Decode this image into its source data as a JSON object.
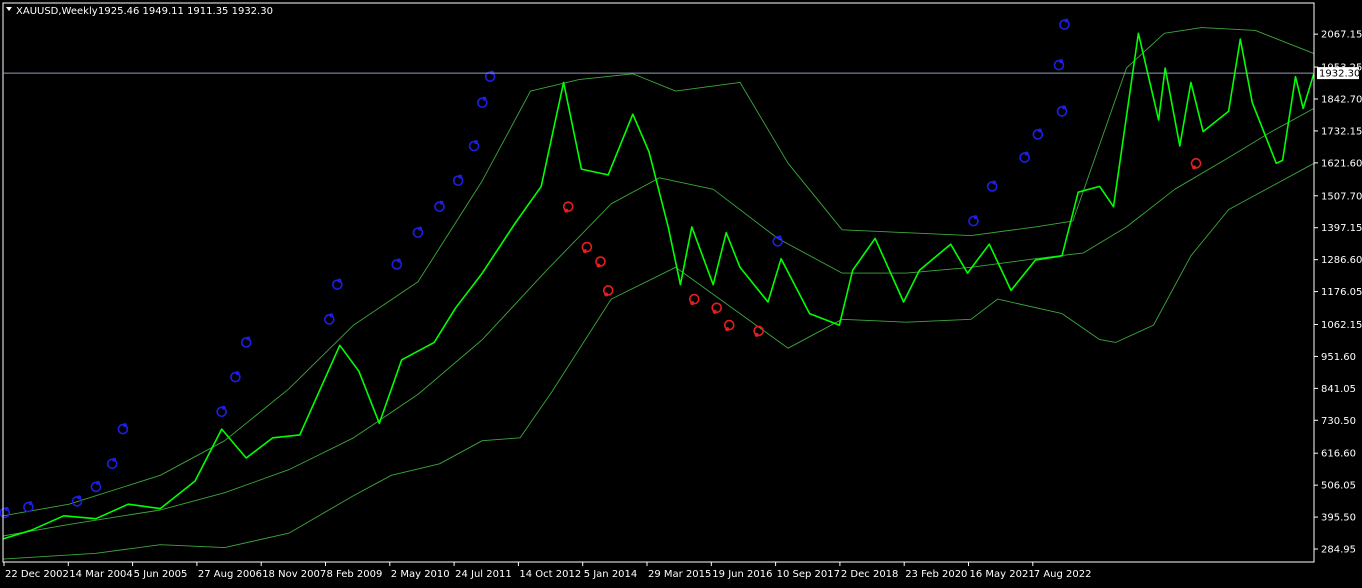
{
  "header": {
    "symbol_title": "XAUUSD,Weekly",
    "ohlc": "1925.46 1949.11 1911.35 1932.30"
  },
  "colors": {
    "background": "#000000",
    "frame": "#ffffff",
    "text": "#ffffff",
    "price": "#00ff00",
    "bands": "#3ca83c",
    "price_line": "#8fa0b3",
    "price_tag_bg": "#ffffff",
    "price_tag_text": "#000000",
    "buy_marker": "#1e1ee6",
    "sell_marker": "#e61e1e"
  },
  "chart_data": {
    "type": "line",
    "title": "",
    "xlabel": "",
    "ylabel": "",
    "ylim": [
      240,
      2175
    ],
    "x_range": [
      "2002-12-22",
      "2023-04-30"
    ],
    "grid": false,
    "y_ticks": [
      "2067.15",
      "1953.25",
      "1842.70",
      "1732.15",
      "1621.60",
      "1507.70",
      "1397.15",
      "1286.60",
      "1176.05",
      "1062.15",
      "951.60",
      "841.05",
      "730.50",
      "616.60",
      "506.05",
      "395.50",
      "284.95"
    ],
    "x_ticks": [
      "22 Dec 2002",
      "14 Mar 2004",
      "5 Jun 2005",
      "27 Aug 2006",
      "18 Nov 2007",
      "8 Feb 2009",
      "2 May 2010",
      "24 Jul 2011",
      "14 Oct 2012",
      "5 Jan 2014",
      "29 Mar 2015",
      "19 Jun 2016",
      "10 Sep 2017",
      "2 Dec 2018",
      "23 Feb 2020",
      "16 May 2021",
      "7 Aug 2022"
    ],
    "current_price": {
      "value": 1932.3,
      "label": "1932.30"
    },
    "series": [
      {
        "type": "line",
        "x": [
          "2002-12-22",
          "2003-06-01",
          "2003-12-01",
          "2004-06-01",
          "2004-12-01",
          "2005-06-01",
          "2005-12-15",
          "2006-05-15",
          "2006-10-01",
          "2007-03-01",
          "2007-08-01",
          "2008-03-15",
          "2008-07-01",
          "2008-10-25",
          "2009-03-01",
          "2009-09-01",
          "2010-01-01",
          "2010-06-01",
          "2010-12-01",
          "2011-05-01",
          "2011-09-05",
          "2011-12-15",
          "2012-05-15",
          "2012-10-01",
          "2013-01-01",
          "2013-04-20",
          "2013-06-28",
          "2013-09-01",
          "2013-12-31",
          "2014-03-15",
          "2014-06-01",
          "2014-11-07",
          "2015-01-20",
          "2015-07-01",
          "2015-12-17",
          "2016-03-01",
          "2016-07-06",
          "2016-12-15",
          "2017-03-15",
          "2017-09-08",
          "2017-12-12",
          "2018-04-15",
          "2018-08-16",
          "2019-01-01",
          "2019-06-01",
          "2019-09-01",
          "2020-01-01",
          "2020-03-19",
          "2020-08-07",
          "2020-11-30",
          "2021-01-06",
          "2021-03-30",
          "2021-06-01",
          "2021-08-09",
          "2022-01-01",
          "2022-03-08",
          "2022-05-15",
          "2022-09-28",
          "2022-11-03",
          "2023-01-15",
          "2023-02-28",
          "2023-04-30"
        ],
        "y": [
          320,
          350,
          400,
          390,
          440,
          425,
          520,
          700,
          600,
          670,
          680,
          990,
          900,
          720,
          940,
          1000,
          1120,
          1240,
          1410,
          1540,
          1900,
          1600,
          1580,
          1790,
          1660,
          1400,
          1200,
          1400,
          1200,
          1380,
          1260,
          1140,
          1290,
          1100,
          1060,
          1250,
          1360,
          1140,
          1250,
          1340,
          1240,
          1340,
          1180,
          1285,
          1300,
          1520,
          1540,
          1470,
          2070,
          1770,
          1950,
          1680,
          1900,
          1730,
          1800,
          2050,
          1830,
          1620,
          1630,
          1920,
          1810,
          1932.3
        ]
      },
      {
        "type": "line",
        "x": [
          "2002-12-22",
          "2004-01-01",
          "2005-06-01",
          "2006-06-01",
          "2007-06-01",
          "2008-06-01",
          "2009-06-01",
          "2010-06-01",
          "2011-06-01",
          "2012-06-01",
          "2013-03-01",
          "2014-01-01",
          "2015-01-01",
          "2016-01-01",
          "2017-01-01",
          "2018-01-01",
          "2019-01-01",
          "2019-10-01",
          "2020-06-01",
          "2021-03-01",
          "2022-01-01",
          "2022-09-01",
          "2023-04-30"
        ],
        "y": [
          330,
          370,
          420,
          480,
          560,
          670,
          820,
          1010,
          1250,
          1480,
          1570,
          1530,
          1360,
          1240,
          1240,
          1260,
          1290,
          1310,
          1400,
          1530,
          1640,
          1730,
          1810
        ]
      },
      {
        "type": "line",
        "x": [
          "2002-12-22",
          "2004-01-01",
          "2005-06-01",
          "2006-06-01",
          "2007-06-01",
          "2008-06-01",
          "2009-06-01",
          "2010-06-01",
          "2011-03-01",
          "2011-12-01",
          "2012-10-01",
          "2013-06-01",
          "2014-06-01",
          "2015-03-01",
          "2016-01-01",
          "2017-01-01",
          "2018-01-01",
          "2019-01-01",
          "2019-08-01",
          "2020-06-01",
          "2021-01-01",
          "2021-08-01",
          "2022-06-01",
          "2023-04-30"
        ],
        "y": [
          400,
          440,
          540,
          660,
          840,
          1060,
          1210,
          1560,
          1870,
          1910,
          1930,
          1870,
          1900,
          1620,
          1390,
          1380,
          1370,
          1400,
          1420,
          1950,
          2070,
          2090,
          2080,
          2000
        ]
      },
      {
        "type": "line",
        "x": [
          "2002-12-22",
          "2004-06-01",
          "2005-06-01",
          "2006-06-01",
          "2007-06-01",
          "2008-06-01",
          "2009-01-01",
          "2009-10-01",
          "2010-06-01",
          "2011-01-01",
          "2011-07-01",
          "2012-06-01",
          "2013-06-01",
          "2014-06-01",
          "2015-03-01",
          "2016-01-01",
          "2017-01-01",
          "2018-01-01",
          "2018-06-01",
          "2019-06-01",
          "2020-01-01",
          "2020-04-01",
          "2020-11-01",
          "2021-06-01",
          "2022-01-01",
          "2022-09-01",
          "2023-04-30"
        ],
        "y": [
          250,
          270,
          300,
          290,
          340,
          470,
          540,
          580,
          660,
          670,
          830,
          1150,
          1260,
          1100,
          980,
          1080,
          1070,
          1080,
          1150,
          1100,
          1010,
          1000,
          1060,
          1300,
          1460,
          1540,
          1620
        ]
      }
    ],
    "buy_markers": {
      "color": "#1e1ee6",
      "points": [
        [
          "2003-01-01",
          410
        ],
        [
          "2003-05-15",
          430
        ],
        [
          "2004-02-15",
          450
        ],
        [
          "2004-06-01",
          500
        ],
        [
          "2004-09-01",
          580
        ],
        [
          "2004-11-01",
          700
        ],
        [
          "2006-05-15",
          760
        ],
        [
          "2006-08-01",
          880
        ],
        [
          "2006-10-01",
          1000
        ],
        [
          "2008-01-15",
          1080
        ],
        [
          "2008-03-01",
          1200
        ],
        [
          "2009-02-01",
          1270
        ],
        [
          "2009-06-01",
          1380
        ],
        [
          "2009-10-01",
          1470
        ],
        [
          "2010-01-15",
          1560
        ],
        [
          "2010-04-15",
          1680
        ],
        [
          "2010-06-01",
          1830
        ],
        [
          "2010-07-15",
          1920
        ],
        [
          "2015-01-01",
          1350
        ],
        [
          "2018-01-15",
          1420
        ],
        [
          "2018-05-01",
          1540
        ],
        [
          "2018-11-01",
          1640
        ],
        [
          "2019-01-15",
          1720
        ],
        [
          "2019-06-01",
          1800
        ],
        [
          "2019-05-15",
          1960
        ],
        [
          "2019-06-15",
          2100
        ]
      ]
    },
    "sell_markers": {
      "color": "#e61e1e",
      "points": [
        [
          "2011-10-01",
          1470
        ],
        [
          "2012-01-15",
          1330
        ],
        [
          "2012-04-01",
          1280
        ],
        [
          "2012-05-15",
          1180
        ],
        [
          "2013-09-15",
          1150
        ],
        [
          "2014-01-20",
          1120
        ],
        [
          "2014-04-01",
          1060
        ],
        [
          "2014-09-15",
          1040
        ],
        [
          "2021-06-30",
          1620
        ]
      ]
    }
  }
}
